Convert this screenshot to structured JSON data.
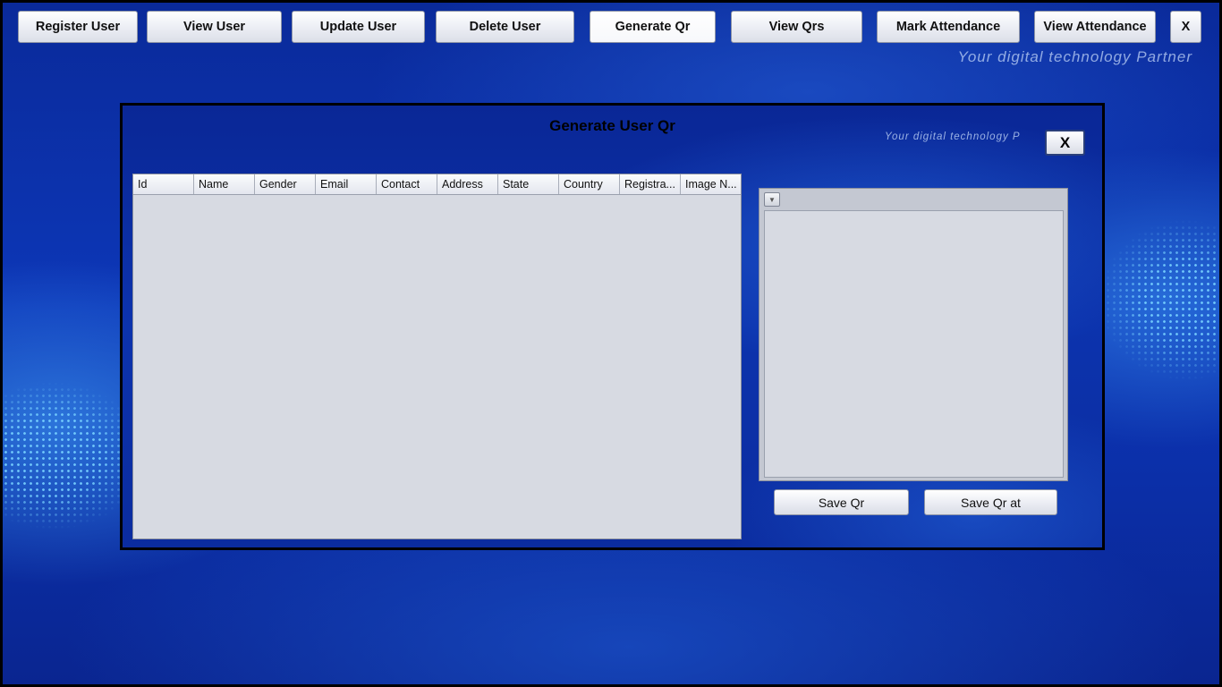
{
  "nav": {
    "register_user": "Register User",
    "view_user": "View User",
    "update_user": "Update User",
    "delete_user": "Delete User",
    "generate_qr": "Generate Qr",
    "view_qrs": "View Qrs",
    "mark_attendance": "Mark Attendance",
    "view_attendance": "View Attendance",
    "close": "X"
  },
  "tagline": "Your digital technology Partner",
  "dialog": {
    "title": "Generate User Qr",
    "tagline_partial": "Your digital technology P",
    "close": "X",
    "table": {
      "columns": [
        "Id",
        "Name",
        "Gender",
        "Email",
        "Contact",
        "Address",
        "State",
        "Country",
        "Registra...",
        "Image N..."
      ],
      "rows": []
    },
    "qr_panel": {
      "toggle_icon": "chevron-down-icon"
    },
    "save_qr": "Save Qr",
    "save_qr_at": "Save Qr at"
  },
  "colors": {
    "background": "#0c33ad",
    "panel": "#d7dae2"
  }
}
